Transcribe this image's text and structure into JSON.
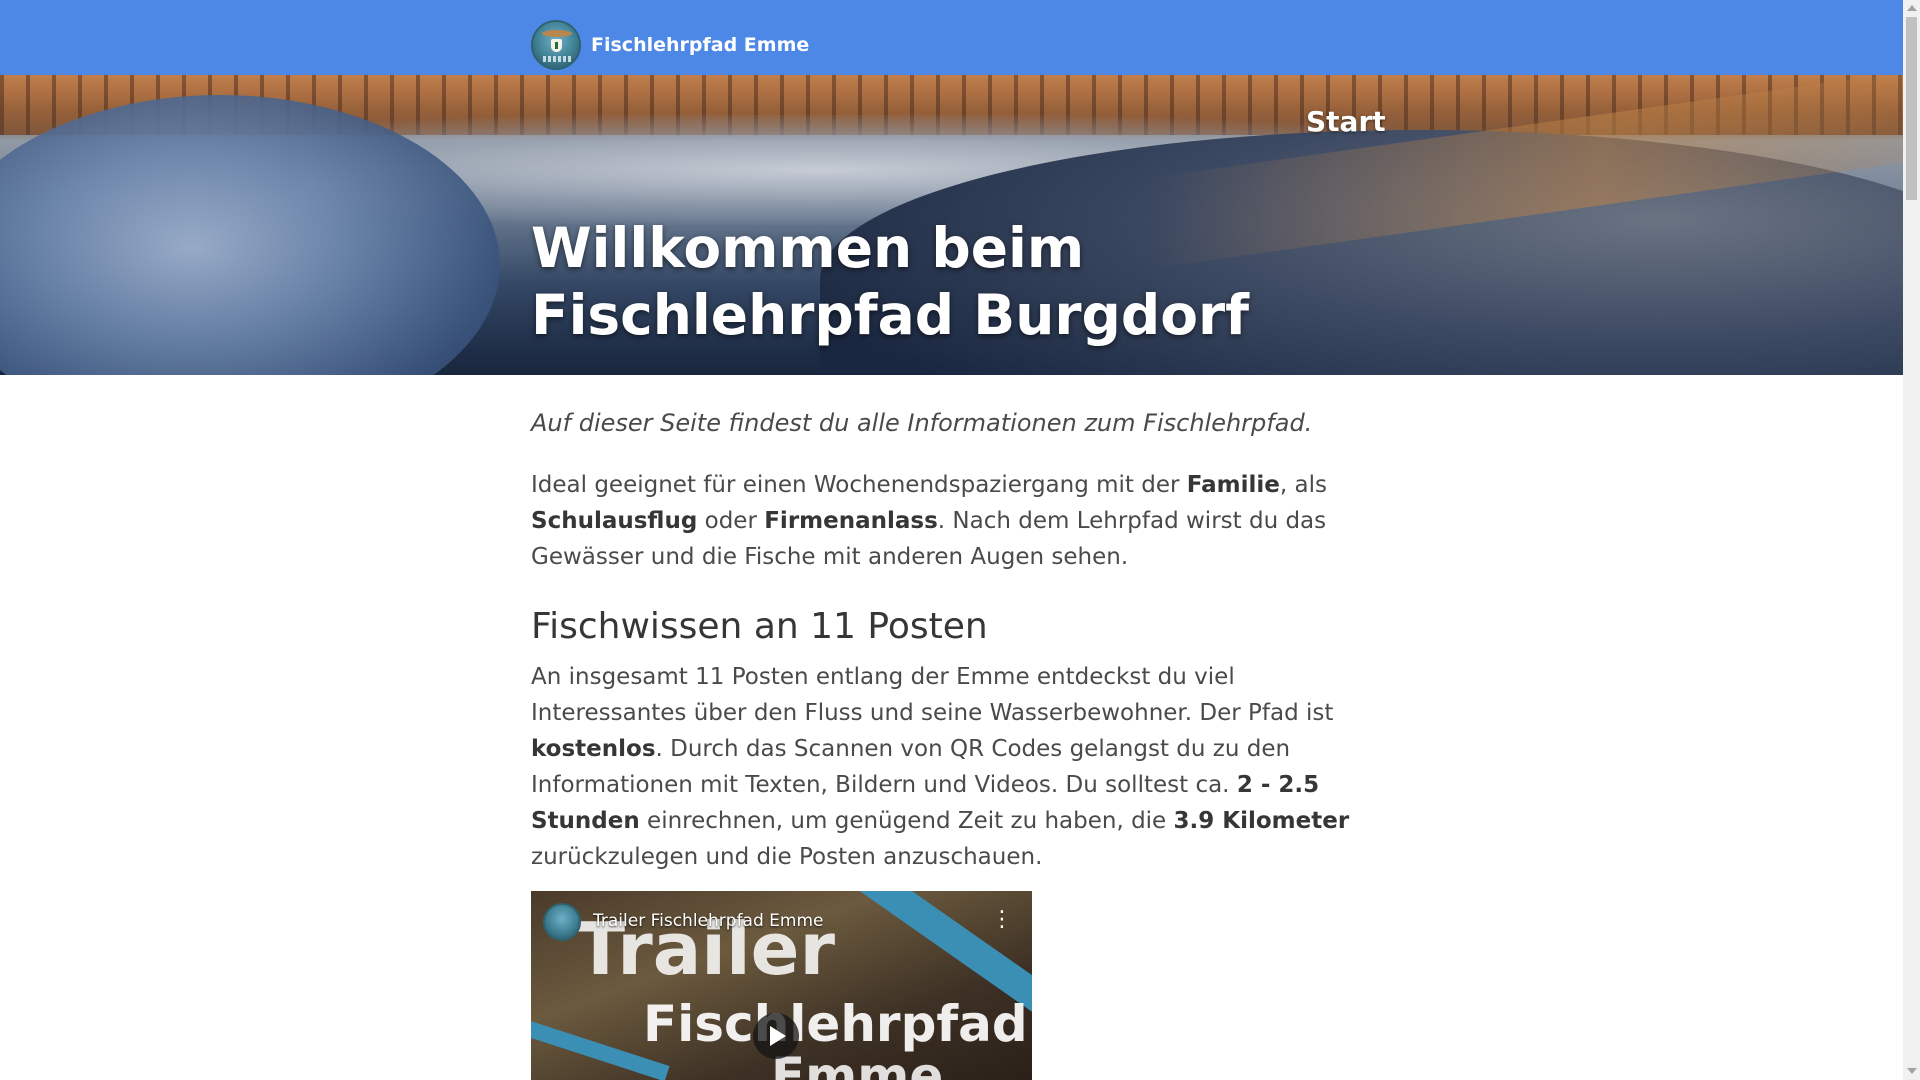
{
  "navbar": {
    "brand_name": "Fischlehrpfad Emme",
    "brand_color": "#4d88e6",
    "logo_icon": "fischlehrpfad-logo-icon"
  },
  "hero": {
    "nav_start": "Start",
    "title_line1": "Willkommen beim",
    "title_line2": "Fischlehrpfad Burgdorf"
  },
  "content": {
    "lead": "Auf dieser Seite findest du alle Informationen zum Fischlehrpfad.",
    "intro": {
      "t1": "Ideal geeignet für einen Wochenendspaziergang mit der ",
      "b1": "Familie",
      "t2": ", als ",
      "b2": "Schulaus­flug",
      "t3": " oder ",
      "b3": "Firmenanlass",
      "t4": ". Nach dem Lehrpfad wirst du das Gewässer und die Fi­sche mit anderen Augen sehen."
    },
    "section_title": "Fischwissen an 11 Posten",
    "section_text": {
      "t1": "An insgesamt 11 Posten entlang der Emme entdeckst du viel Interessantes über den Fluss und seine Wasserbewohner. Der Pfad ist ",
      "b1": "kostenlos",
      "t2": ". Durch das Scan­nen von QR Codes gelangst du zu den Informationen mit Texten, Bildern und Videos. Du solltest ca. ",
      "b2": "2 - 2.5 Stunden",
      "t3": " einrechnen, um genügend Zeit zu ha­ben, die ",
      "b3": "3.9 Kilometer",
      "t4": " zurückzulegen und die Posten anzuschauen."
    }
  },
  "video": {
    "title": "Trailer Fischlehrpfad Emme",
    "overlay_line1": "Trailer",
    "overlay_line2": "Fischlehrpfad",
    "overlay_line3": "Emme",
    "menu_icon": "more-vert-icon",
    "play_icon": "play-icon"
  }
}
